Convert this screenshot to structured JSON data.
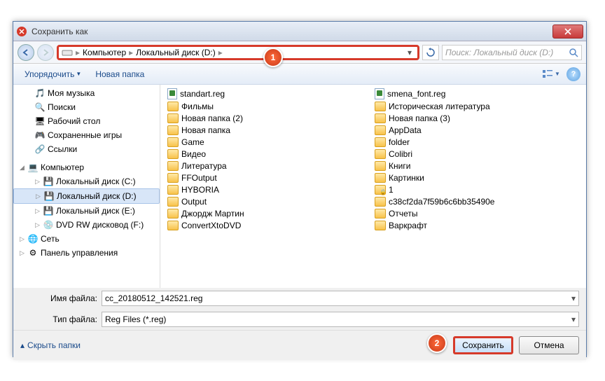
{
  "title": "Сохранить как",
  "breadcrumb": {
    "seg1": "Компьютер",
    "seg2": "Локальный диск (D:)"
  },
  "search": {
    "placeholder": "Поиск: Локальный диск (D:)"
  },
  "toolbar": {
    "organize": "Упорядочить",
    "newfolder": "Новая папка"
  },
  "tree": {
    "mymusic": "Моя музыка",
    "searches": "Поиски",
    "desktop": "Рабочий стол",
    "savedgames": "Сохраненные игры",
    "links": "Ссылки",
    "computer": "Компьютер",
    "diskC": "Локальный диск (C:)",
    "diskD": "Локальный диск (D:)",
    "diskE": "Локальный диск (E:)",
    "dvd": "DVD RW дисковод (F:)",
    "network": "Сеть",
    "cpanel": "Панель управления"
  },
  "files_col1": [
    {
      "n": "standart.reg",
      "t": "reg"
    },
    {
      "n": "Фильмы",
      "t": "f"
    },
    {
      "n": "Новая папка (2)",
      "t": "f"
    },
    {
      "n": "Новая папка",
      "t": "f"
    },
    {
      "n": "Game",
      "t": "f"
    },
    {
      "n": "Видео",
      "t": "f"
    },
    {
      "n": "Литература",
      "t": "f"
    },
    {
      "n": "FFOutput",
      "t": "f"
    },
    {
      "n": "HYBORIA",
      "t": "f"
    },
    {
      "n": "Output",
      "t": "f"
    },
    {
      "n": "Джордж Мартин",
      "t": "f"
    },
    {
      "n": "ConvertXtoDVD",
      "t": "f"
    }
  ],
  "files_col2": [
    {
      "n": "smena_font.reg",
      "t": "reg"
    },
    {
      "n": "Историческая литература",
      "t": "f"
    },
    {
      "n": "Новая папка (3)",
      "t": "f"
    },
    {
      "n": "AppData",
      "t": "f"
    },
    {
      "n": "folder",
      "t": "f"
    },
    {
      "n": "Colibri",
      "t": "f"
    },
    {
      "n": "Книги",
      "t": "f"
    },
    {
      "n": "Картинки",
      "t": "f"
    },
    {
      "n": "1",
      "t": "lock"
    },
    {
      "n": "c38cf2da7f59b6c6bb35490e",
      "t": "f"
    },
    {
      "n": "Отчеты",
      "t": "f"
    },
    {
      "n": "Варкрафт",
      "t": "f"
    }
  ],
  "form": {
    "filename_label": "Имя файла:",
    "filename_value": "cc_20180512_142521.reg",
    "filetype_label": "Тип файла:",
    "filetype_value": "Reg Files (*.reg)"
  },
  "bottom": {
    "hide": "Скрыть папки",
    "save": "Сохранить",
    "cancel": "Отмена"
  },
  "badges": {
    "b1": "1",
    "b2": "2"
  }
}
